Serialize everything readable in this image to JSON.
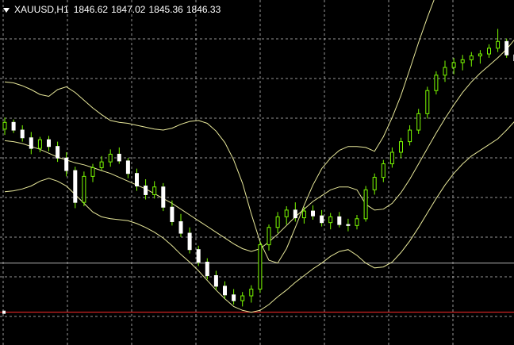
{
  "header": {
    "symbol": "XAUUSD,H1",
    "open": "1846.62",
    "high": "1847.02",
    "low": "1845.36",
    "close": "1846.33"
  },
  "colors": {
    "background": "#000000",
    "grid": "#c8c8c8",
    "bull_candle": "#7CFC00",
    "bear_candle": "#ffffff",
    "bands": "#e8e89a",
    "hline_level": "#ff2a2a",
    "hline_level2": "#b0b0b0"
  },
  "icons": {
    "menu": "triangle-down"
  },
  "chart_data": {
    "type": "candlestick",
    "candles_ohlc": [
      [
        1839.2,
        1840.4,
        1838.6,
        1839.9
      ],
      [
        1839.9,
        1840.2,
        1838.8,
        1839.1
      ],
      [
        1839.1,
        1839.6,
        1837.9,
        1838.3
      ],
      [
        1838.3,
        1838.9,
        1836.6,
        1837.2
      ],
      [
        1837.2,
        1838.4,
        1836.8,
        1838.1
      ],
      [
        1838.1,
        1838.5,
        1836.9,
        1837.4
      ],
      [
        1837.4,
        1837.9,
        1835.8,
        1836.2
      ],
      [
        1836.2,
        1836.8,
        1834.3,
        1834.9
      ],
      [
        1834.9,
        1835.3,
        1831.0,
        1831.6
      ],
      [
        1831.6,
        1834.8,
        1831.2,
        1834.3
      ],
      [
        1834.3,
        1835.6,
        1833.7,
        1835.2
      ],
      [
        1835.2,
        1836.4,
        1834.9,
        1835.8
      ],
      [
        1835.8,
        1837.1,
        1835.3,
        1836.6
      ],
      [
        1836.6,
        1837.3,
        1835.6,
        1835.9
      ],
      [
        1835.9,
        1836.2,
        1834.1,
        1834.6
      ],
      [
        1834.6,
        1835.1,
        1832.8,
        1833.3
      ],
      [
        1833.3,
        1834.0,
        1831.9,
        1832.4
      ],
      [
        1832.4,
        1833.8,
        1832.0,
        1833.2
      ],
      [
        1833.2,
        1833.6,
        1830.7,
        1831.1
      ],
      [
        1831.1,
        1831.8,
        1829.2,
        1829.6
      ],
      [
        1829.6,
        1830.4,
        1828.0,
        1828.4
      ],
      [
        1828.4,
        1829.0,
        1826.3,
        1826.7
      ],
      [
        1826.7,
        1827.1,
        1825.0,
        1825.4
      ],
      [
        1825.4,
        1825.8,
        1823.6,
        1824.0
      ],
      [
        1824.0,
        1824.5,
        1822.5,
        1822.9
      ],
      [
        1822.9,
        1823.4,
        1821.6,
        1822.0
      ],
      [
        1822.0,
        1822.6,
        1821.0,
        1821.4
      ],
      [
        1821.4,
        1822.3,
        1820.8,
        1821.9
      ],
      [
        1821.9,
        1823.0,
        1821.2,
        1822.6
      ],
      [
        1822.6,
        1827.6,
        1822.2,
        1827.2
      ],
      [
        1827.2,
        1829.3,
        1826.6,
        1829.0
      ],
      [
        1829.0,
        1830.6,
        1828.4,
        1830.1
      ],
      [
        1830.1,
        1831.2,
        1829.3,
        1830.8
      ],
      [
        1830.8,
        1831.6,
        1829.6,
        1830.0
      ],
      [
        1830.0,
        1831.1,
        1829.4,
        1830.7
      ],
      [
        1830.7,
        1831.3,
        1829.8,
        1830.2
      ],
      [
        1830.2,
        1830.8,
        1829.1,
        1829.5
      ],
      [
        1829.5,
        1830.5,
        1828.8,
        1830.1
      ],
      [
        1830.1,
        1830.6,
        1829.0,
        1829.3
      ],
      [
        1829.3,
        1829.9,
        1828.6,
        1829.2
      ],
      [
        1829.2,
        1830.3,
        1828.8,
        1829.9
      ],
      [
        1829.9,
        1833.3,
        1829.6,
        1832.9
      ],
      [
        1832.9,
        1834.6,
        1832.4,
        1834.2
      ],
      [
        1834.2,
        1836.0,
        1833.7,
        1835.6
      ],
      [
        1835.6,
        1837.3,
        1835.2,
        1836.8
      ],
      [
        1836.8,
        1838.3,
        1836.2,
        1837.9
      ],
      [
        1837.9,
        1839.6,
        1837.5,
        1839.1
      ],
      [
        1839.1,
        1841.3,
        1838.7,
        1840.8
      ],
      [
        1840.8,
        1843.6,
        1840.3,
        1843.2
      ],
      [
        1843.2,
        1845.2,
        1842.8,
        1844.8
      ],
      [
        1844.8,
        1846.3,
        1844.1,
        1845.6
      ],
      [
        1845.6,
        1846.6,
        1844.9,
        1846.1
      ],
      [
        1846.1,
        1846.9,
        1845.3,
        1846.4
      ],
      [
        1846.4,
        1847.2,
        1845.7,
        1846.8
      ],
      [
        1846.8,
        1847.4,
        1846.0,
        1847.0
      ],
      [
        1847.0,
        1848.0,
        1846.6,
        1847.6
      ],
      [
        1847.6,
        1849.6,
        1847.2,
        1848.3
      ],
      [
        1848.3,
        1848.6,
        1846.6,
        1846.9
      ],
      [
        1846.9,
        1847.2,
        1845.9,
        1846.3
      ]
    ],
    "bands": {
      "upper": [
        1844.1,
        1844.0,
        1843.7,
        1843.3,
        1842.8,
        1842.6,
        1843.3,
        1843.6,
        1843.0,
        1842.2,
        1841.4,
        1840.7,
        1840.1,
        1839.9,
        1839.8,
        1839.6,
        1839.4,
        1839.2,
        1839.1,
        1839.3,
        1839.7,
        1840.0,
        1840.1,
        1839.8,
        1839.0,
        1837.8,
        1836.0,
        1833.6,
        1830.4,
        1827.5,
        1825.6,
        1825.3,
        1826.8,
        1829.0,
        1831.3,
        1833.4,
        1835.1,
        1836.2,
        1837.0,
        1837.4,
        1837.4,
        1837.3,
        1836.9,
        1838.4,
        1840.4,
        1842.7,
        1845.4,
        1848.2,
        1850.8,
        1853.2,
        1855.6,
        1857.5,
        1858.8,
        1859.8,
        1860.2,
        1860.3,
        1860.3,
        1860.2,
        1860.1
      ],
      "middle": [
        1838.0,
        1837.9,
        1837.7,
        1837.4,
        1837.1,
        1836.7,
        1836.3,
        1836.0,
        1835.7,
        1835.5,
        1835.2,
        1834.9,
        1834.6,
        1834.2,
        1833.8,
        1833.4,
        1833.0,
        1832.5,
        1832.0,
        1831.5,
        1830.9,
        1830.3,
        1829.7,
        1829.1,
        1828.5,
        1827.9,
        1827.3,
        1826.8,
        1826.5,
        1826.8,
        1827.5,
        1828.3,
        1829.2,
        1830.1,
        1830.9,
        1831.7,
        1832.3,
        1832.9,
        1833.2,
        1833.2,
        1832.9,
        1831.4,
        1830.8,
        1830.9,
        1831.5,
        1832.6,
        1834.0,
        1835.6,
        1837.2,
        1838.8,
        1840.3,
        1841.7,
        1843.0,
        1844.1,
        1845.0,
        1845.8,
        1846.6,
        1847.5,
        1848.6
      ],
      "lower": [
        1832.7,
        1832.8,
        1833.0,
        1833.3,
        1833.8,
        1834.1,
        1833.8,
        1833.3,
        1832.4,
        1831.5,
        1830.6,
        1830.1,
        1829.9,
        1829.8,
        1829.7,
        1829.4,
        1829.0,
        1828.5,
        1827.9,
        1827.1,
        1826.2,
        1825.4,
        1824.5,
        1823.5,
        1822.5,
        1821.6,
        1820.8,
        1820.4,
        1820.2,
        1820.4,
        1821.0,
        1821.8,
        1822.5,
        1823.3,
        1824.0,
        1824.7,
        1825.3,
        1826.0,
        1826.5,
        1826.7,
        1826.1,
        1825.3,
        1824.8,
        1824.9,
        1825.4,
        1826.4,
        1827.6,
        1829.0,
        1830.5,
        1832.0,
        1833.4,
        1834.6,
        1835.6,
        1836.4,
        1837.0,
        1837.6,
        1838.2,
        1839.1,
        1840.1
      ]
    },
    "hlines": [
      1820.2,
      1825.3
    ],
    "ylim": [
      1816.8,
      1852.6
    ]
  }
}
